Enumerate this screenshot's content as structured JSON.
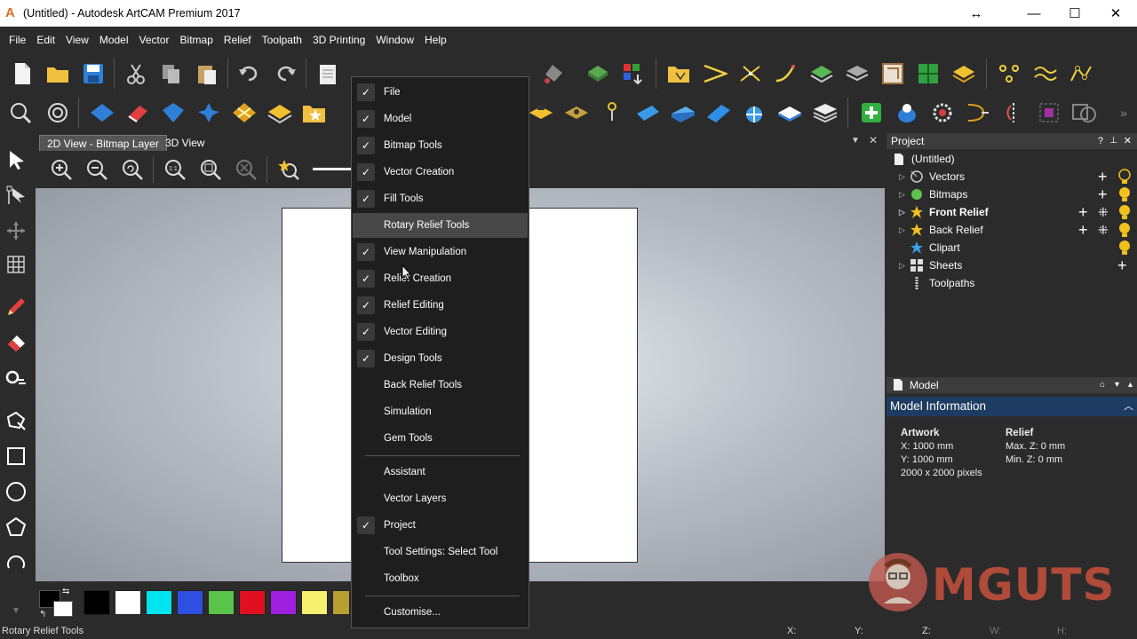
{
  "window": {
    "title": "(Untitled) - Autodesk ArtCAM Premium 2017",
    "app_icon_letter": "A"
  },
  "menu": [
    "File",
    "Edit",
    "View",
    "Model",
    "Vector",
    "Bitmap",
    "Relief",
    "Toolpath",
    "3D Printing",
    "Window",
    "Help"
  ],
  "view_tabs": [
    "2D View - Bitmap Layer",
    "3D View"
  ],
  "project_panel": {
    "title": "Project",
    "root": "(Untitled)",
    "items": [
      "Vectors",
      "Bitmaps",
      "Front Relief",
      "Back Relief",
      "Clipart",
      "Sheets",
      "Toolpaths"
    ]
  },
  "model_panel": {
    "title": "Model",
    "info_title": "Model Information",
    "artwork_heading": "Artwork",
    "artwork_x": "X: 1000 mm",
    "artwork_y": "Y: 1000 mm",
    "artwork_pixels": "2000 x 2000 pixels",
    "relief_heading": "Relief",
    "relief_max": "Max. Z: 0 mm",
    "relief_min": "Min. Z: 0 mm"
  },
  "context_menu": {
    "items": [
      {
        "label": "File",
        "checked": true
      },
      {
        "label": "Model",
        "checked": true
      },
      {
        "label": "Bitmap Tools",
        "checked": true
      },
      {
        "label": "Vector Creation",
        "checked": true
      },
      {
        "label": "Fill Tools",
        "checked": true
      },
      {
        "label": "Rotary Relief Tools",
        "checked": false,
        "highlighted": true
      },
      {
        "label": "View Manipulation",
        "checked": true
      },
      {
        "label": "Relief Creation",
        "checked": true
      },
      {
        "label": "Relief Editing",
        "checked": true
      },
      {
        "label": "Vector Editing",
        "checked": true
      },
      {
        "label": "Design Tools",
        "checked": true
      },
      {
        "label": "Back Relief Tools",
        "checked": false
      },
      {
        "label": "Simulation",
        "checked": false
      },
      {
        "label": "Gem Tools",
        "checked": false
      },
      {
        "label": "Assistant",
        "checked": false
      },
      {
        "label": "Vector Layers",
        "checked": false
      },
      {
        "label": "Project",
        "checked": true
      },
      {
        "label": "Tool Settings: Select Tool",
        "checked": false
      },
      {
        "label": "Toolbox",
        "checked": false
      },
      {
        "label": "Customise...",
        "checked": false
      }
    ]
  },
  "palette_colors": [
    "#000000",
    "#ffffff",
    "#00e5f0",
    "#2f4fe0",
    "#59c449",
    "#e01020",
    "#a020e0",
    "#f5f070",
    "#b8a030"
  ],
  "status": {
    "message": "Rotary Relief Tools",
    "x_label": "X:",
    "y_label": "Y:",
    "z_label": "Z:",
    "w_label": "W:",
    "h_label": "H:"
  },
  "watermark_text": "MGUTS"
}
